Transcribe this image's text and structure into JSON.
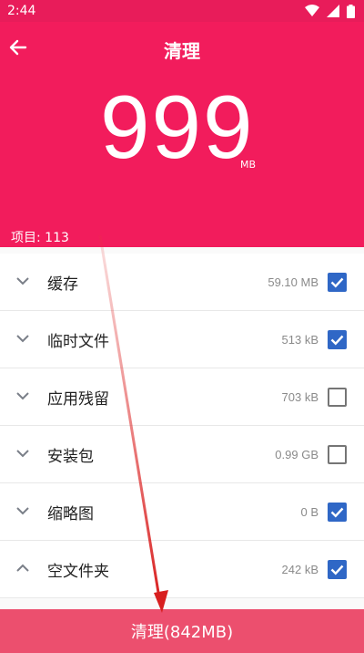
{
  "status_bar": {
    "time": "2:44"
  },
  "header": {
    "title": "清理",
    "total_size": "999",
    "unit": "MB",
    "items_count": "项目: 113"
  },
  "categories": [
    {
      "label": "缓存",
      "size": "59.10 MB",
      "checked": true,
      "expanded": false
    },
    {
      "label": "临时文件",
      "size": "513 kB",
      "checked": true,
      "expanded": false
    },
    {
      "label": "应用残留",
      "size": "703 kB",
      "checked": false,
      "expanded": false
    },
    {
      "label": "安装包",
      "size": "0.99 GB",
      "checked": false,
      "expanded": false
    },
    {
      "label": "缩略图",
      "size": "0 B",
      "checked": true,
      "expanded": false
    },
    {
      "label": "空文件夹",
      "size": "242 kB",
      "checked": true,
      "expanded": true
    }
  ],
  "bottom_button": {
    "label": "清理(842MB)"
  },
  "colors": {
    "accent": "#f21c5c",
    "button": "#ec4f6e",
    "checkbox": "#2f67c6"
  },
  "icons": [
    "wifi-icon",
    "signal-icon",
    "battery-icon",
    "back-arrow-icon",
    "chevron-down-icon",
    "chevron-up-icon",
    "checkbox-icon"
  ]
}
